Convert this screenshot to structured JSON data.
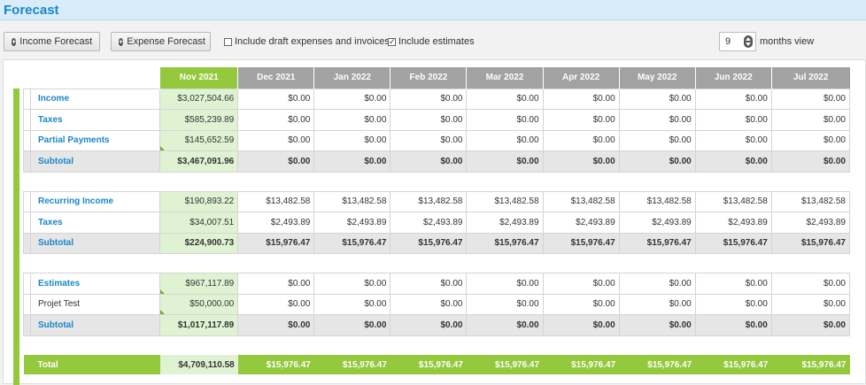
{
  "page": {
    "title": "Forecast"
  },
  "toolbar": {
    "income_btn": "Income Forecast",
    "expense_btn": "Expense Forecast",
    "draft_label": "Include draft expenses and invoices",
    "draft_checked": false,
    "estimates_label": "Include estimates",
    "estimates_checked": true,
    "months_value": "9",
    "months_label": "months view"
  },
  "colors": {
    "accent_green": "#94c83d",
    "header_gray": "#a2a2a2",
    "link_blue": "#1a86c8",
    "current_cell": "#dff3d3"
  },
  "months": [
    "Nov 2021",
    "Dec 2021",
    "Jan 2022",
    "Feb 2022",
    "Mar 2022",
    "Apr 2022",
    "May 2022",
    "Jun 2022",
    "Jul 2022"
  ],
  "sections": [
    {
      "rows": [
        {
          "label": "Income",
          "values": [
            "$3,027,504.66",
            "$0.00",
            "$0.00",
            "$0.00",
            "$0.00",
            "$0.00",
            "$0.00",
            "$0.00",
            "$0.00"
          ]
        },
        {
          "label": "Taxes",
          "values": [
            "$585,239.89",
            "$0.00",
            "$0.00",
            "$0.00",
            "$0.00",
            "$0.00",
            "$0.00",
            "$0.00",
            "$0.00"
          ]
        },
        {
          "label": "Partial Payments",
          "values": [
            "$145,652.59",
            "$0.00",
            "$0.00",
            "$0.00",
            "$0.00",
            "$0.00",
            "$0.00",
            "$0.00",
            "$0.00"
          ]
        }
      ],
      "subtotal": {
        "label": "Subtotal",
        "values": [
          "$3,467,091.96",
          "$0.00",
          "$0.00",
          "$0.00",
          "$0.00",
          "$0.00",
          "$0.00",
          "$0.00",
          "$0.00"
        ]
      }
    },
    {
      "rows": [
        {
          "label": "Recurring Income",
          "values": [
            "$190,893.22",
            "$13,482.58",
            "$13,482.58",
            "$13,482.58",
            "$13,482.58",
            "$13,482.58",
            "$13,482.58",
            "$13,482.58",
            "$13,482.58"
          ]
        },
        {
          "label": "Taxes",
          "values": [
            "$34,007.51",
            "$2,493.89",
            "$2,493.89",
            "$2,493.89",
            "$2,493.89",
            "$2,493.89",
            "$2,493.89",
            "$2,493.89",
            "$2,493.89"
          ]
        }
      ],
      "subtotal": {
        "label": "Subtotal",
        "values": [
          "$224,900.73",
          "$15,976.47",
          "$15,976.47",
          "$15,976.47",
          "$15,976.47",
          "$15,976.47",
          "$15,976.47",
          "$15,976.47",
          "$15,976.47"
        ]
      }
    },
    {
      "rows": [
        {
          "label": "Estimates",
          "values": [
            "$967,117.89",
            "$0.00",
            "$0.00",
            "$0.00",
            "$0.00",
            "$0.00",
            "$0.00",
            "$0.00",
            "$0.00"
          ]
        },
        {
          "label": "Projet Test",
          "values": [
            "$50,000.00",
            "$0.00",
            "$0.00",
            "$0.00",
            "$0.00",
            "$0.00",
            "$0.00",
            "$0.00",
            "$0.00"
          ]
        }
      ],
      "subtotal": {
        "label": "Subtotal",
        "values": [
          "$1,017,117.89",
          "$0.00",
          "$0.00",
          "$0.00",
          "$0.00",
          "$0.00",
          "$0.00",
          "$0.00",
          "$0.00"
        ]
      }
    }
  ],
  "total": {
    "label": "Total",
    "values": [
      "$4,709,110.58",
      "$15,976.47",
      "$15,976.47",
      "$15,976.47",
      "$15,976.47",
      "$15,976.47",
      "$15,976.47",
      "$15,976.47",
      "$15,976.47"
    ]
  }
}
